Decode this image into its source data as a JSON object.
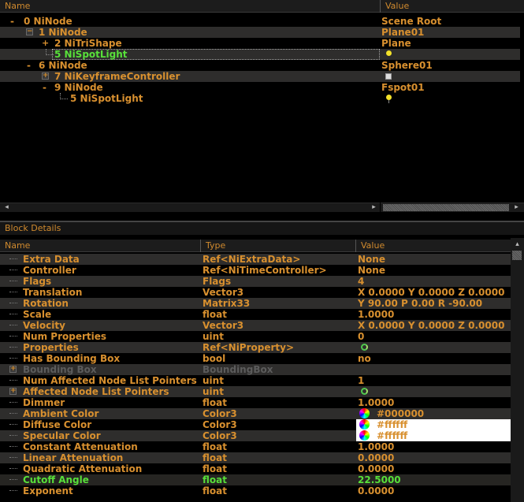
{
  "tree": {
    "col_name": "Name",
    "col_value": "Value",
    "rows": [
      {
        "label": "0 NiNode",
        "value": "Scene Root"
      },
      {
        "label": "1 NiNode",
        "value": "Plane01"
      },
      {
        "label": "2 NiTriShape",
        "value": "Plane"
      },
      {
        "label": "5 NiSpotLight",
        "value": ""
      },
      {
        "label": "6 NiNode",
        "value": "Sphere01"
      },
      {
        "label": "7 NiKeyframeController",
        "value": ""
      },
      {
        "label": "9 NiNode",
        "value": "Fspot01"
      },
      {
        "label": "5 NiSpotLight",
        "value": ""
      }
    ]
  },
  "details": {
    "title": "Block Details",
    "col_name": "Name",
    "col_type": "Type",
    "col_value": "Value",
    "rows": [
      {
        "name": "Extra Data",
        "type": "Ref<NiExtraData>",
        "value": "None"
      },
      {
        "name": "Controller",
        "type": "Ref<NiTimeController>",
        "value": "None"
      },
      {
        "name": "Flags",
        "type": "Flags",
        "value": "4"
      },
      {
        "name": "Translation",
        "type": "Vector3",
        "value": "X 0.0000 Y 0.0000 Z 0.0000"
      },
      {
        "name": "Rotation",
        "type": "Matrix33",
        "value": "Y 90.00 P 0.00 R -90.00"
      },
      {
        "name": "Scale",
        "type": "float",
        "value": "1.0000"
      },
      {
        "name": "Velocity",
        "type": "Vector3",
        "value": "X 0.0000 Y 0.0000 Z 0.0000"
      },
      {
        "name": "Num Properties",
        "type": "uint",
        "value": "0"
      },
      {
        "name": "Properties",
        "type": "Ref<NiProperty>",
        "value": ""
      },
      {
        "name": "Has Bounding Box",
        "type": "bool",
        "value": "no"
      },
      {
        "name": "Bounding Box",
        "type": "BoundingBox",
        "value": ""
      },
      {
        "name": "Num Affected Node List Pointers",
        "type": "uint",
        "value": "1"
      },
      {
        "name": "Affected Node List Pointers",
        "type": "uint",
        "value": ""
      },
      {
        "name": "Dimmer",
        "type": "float",
        "value": "1.0000"
      },
      {
        "name": "Ambient Color",
        "type": "Color3",
        "value": "#000000"
      },
      {
        "name": "Diffuse Color",
        "type": "Color3",
        "value": "#ffffff"
      },
      {
        "name": "Specular Color",
        "type": "Color3",
        "value": "#ffffff"
      },
      {
        "name": "Constant Attenuation",
        "type": "float",
        "value": "1.0000"
      },
      {
        "name": "Linear Attenuation",
        "type": "float",
        "value": "0.0000"
      },
      {
        "name": "Quadratic Attenuation",
        "type": "float",
        "value": "0.0000"
      },
      {
        "name": "Cutoff Angle",
        "type": "float",
        "value": "22.5000"
      },
      {
        "name": "Exponent",
        "type": "float",
        "value": "0.0000"
      }
    ]
  },
  "colors": {
    "accent_text": "#d8902f",
    "selected_text": "#58e03a",
    "disabled_text": "#5c5c5c",
    "alt_row": "#2e2d2c",
    "background": "#000000"
  }
}
